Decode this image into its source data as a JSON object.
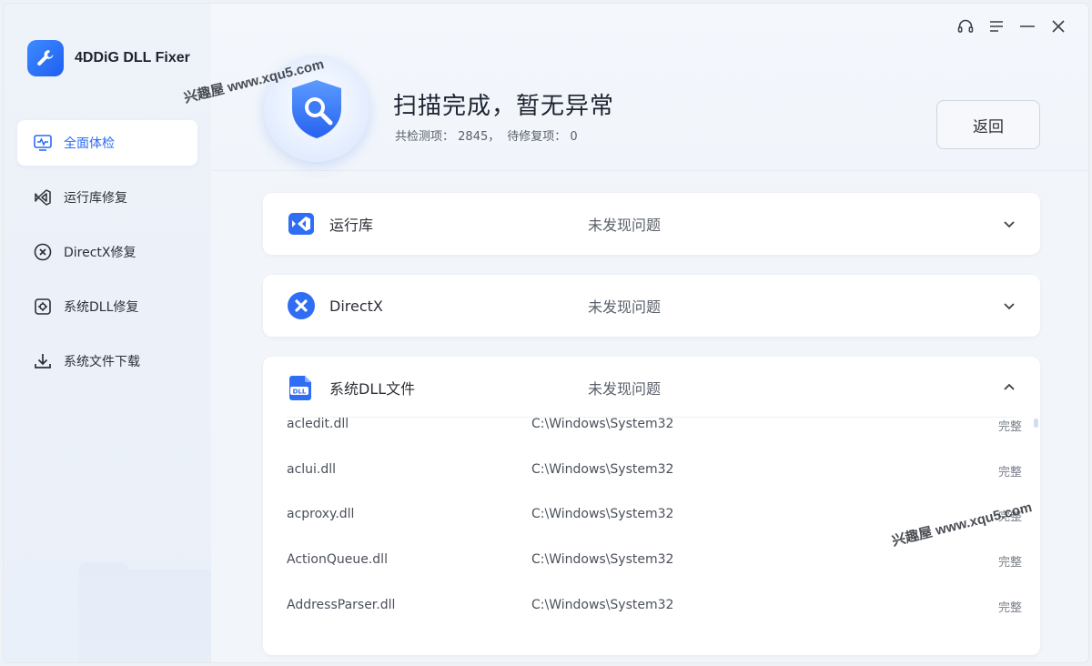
{
  "app": {
    "name": "4DDiG DLL Fixer"
  },
  "sidebar": {
    "items": [
      {
        "label": "全面体检",
        "icon": "monitor-pulse-icon",
        "active": true
      },
      {
        "label": "运行库修复",
        "icon": "vs-code-icon",
        "active": false
      },
      {
        "label": "DirectX修复",
        "icon": "directx-icon",
        "active": false
      },
      {
        "label": "系统DLL修复",
        "icon": "gear-file-icon",
        "active": false
      },
      {
        "label": "系统文件下载",
        "icon": "download-icon",
        "active": false
      }
    ]
  },
  "header": {
    "title": "扫描完成，暂无异常",
    "checked_label": "共检测项：",
    "checked_value": "2845",
    "separator": "，",
    "repair_label": "待修复项：",
    "repair_value": "0",
    "back_label": "返回"
  },
  "sections": [
    {
      "title": "运行库",
      "status": "未发现问题",
      "expanded": false
    },
    {
      "title": "DirectX",
      "status": "未发现问题",
      "expanded": false
    },
    {
      "title": "系统DLL文件",
      "status": "未发现问题",
      "expanded": true
    }
  ],
  "dll_rows": [
    {
      "name": "acledit.dll",
      "path": "C:\\Windows\\System32",
      "status": "完整"
    },
    {
      "name": "aclui.dll",
      "path": "C:\\Windows\\System32",
      "status": "完整"
    },
    {
      "name": "acproxy.dll",
      "path": "C:\\Windows\\System32",
      "status": "完整"
    },
    {
      "name": "ActionQueue.dll",
      "path": "C:\\Windows\\System32",
      "status": "完整"
    },
    {
      "name": "AddressParser.dll",
      "path": "C:\\Windows\\System32",
      "status": "完整"
    }
  ],
  "watermark": {
    "text": "兴趣屋 www.xqu5.com"
  },
  "colors": {
    "accent": "#2a6cf5",
    "brand": "#1f5ef2"
  }
}
